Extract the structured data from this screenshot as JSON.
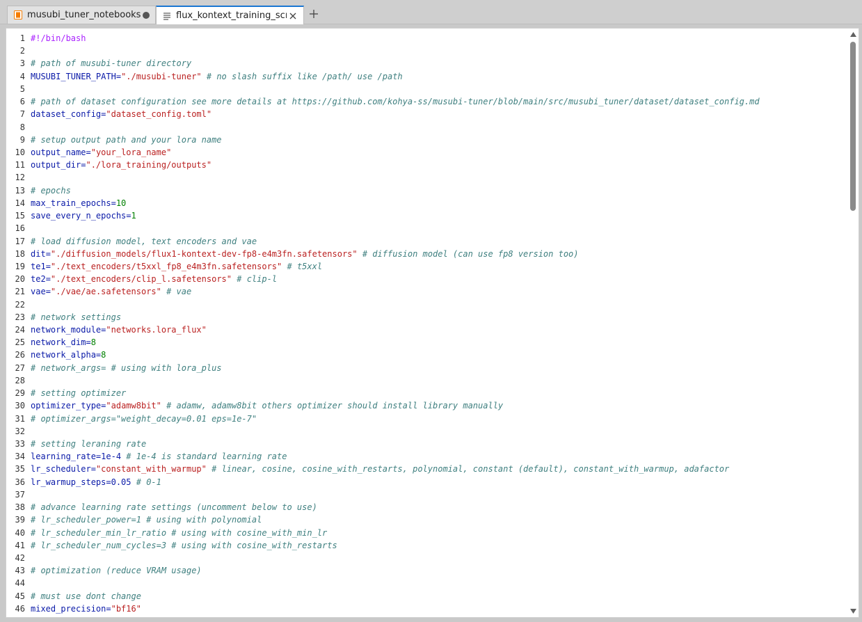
{
  "tabs": [
    {
      "label": "musubi_tuner_notebooks.ipy",
      "icon": "notebook-icon",
      "modified": true,
      "active": false
    },
    {
      "label": "flux_kontext_training_script.s",
      "icon": "text-file-icon",
      "modified": false,
      "active": true
    }
  ],
  "colors": {
    "accent": "#1976d2",
    "notebook_icon": "#f57c00",
    "comment": "#408080",
    "string": "#ba2121",
    "number": "#008000",
    "variable": "#0a1aa8",
    "shebang": "#aa22ff"
  },
  "editor": {
    "lines": [
      {
        "n": "1",
        "tokens": [
          {
            "t": "#!/bin/bash",
            "c": "shebang"
          }
        ]
      },
      {
        "n": "2",
        "tokens": []
      },
      {
        "n": "3",
        "tokens": [
          {
            "t": "# path of musubi-tuner directory",
            "c": "comment"
          }
        ]
      },
      {
        "n": "4",
        "tokens": [
          {
            "t": "MUSUBI_TUNER_PATH",
            "c": "var"
          },
          {
            "t": "=",
            "c": "op"
          },
          {
            "t": "\"./musubi-tuner\"",
            "c": "str"
          },
          {
            "t": " # no slash suffix like /path/ use /path",
            "c": "comment"
          }
        ]
      },
      {
        "n": "5",
        "tokens": []
      },
      {
        "n": "6",
        "tokens": [
          {
            "t": "# path of dataset configuration see more details at https://github.com/kohya-ss/musubi-tuner/blob/main/src/musubi_tuner/dataset/dataset_config.md",
            "c": "comment"
          }
        ]
      },
      {
        "n": "7",
        "tokens": [
          {
            "t": "dataset_config",
            "c": "var"
          },
          {
            "t": "=",
            "c": "op"
          },
          {
            "t": "\"dataset_config.toml\"",
            "c": "str"
          }
        ]
      },
      {
        "n": "8",
        "tokens": []
      },
      {
        "n": "9",
        "tokens": [
          {
            "t": "# setup output path and your lora name",
            "c": "comment"
          }
        ]
      },
      {
        "n": "10",
        "tokens": [
          {
            "t": "output_name",
            "c": "var"
          },
          {
            "t": "=",
            "c": "op"
          },
          {
            "t": "\"your_lora_name\"",
            "c": "str"
          }
        ]
      },
      {
        "n": "11",
        "tokens": [
          {
            "t": "output_dir",
            "c": "var"
          },
          {
            "t": "=",
            "c": "op"
          },
          {
            "t": "\"./lora_training/outputs\"",
            "c": "str"
          }
        ]
      },
      {
        "n": "12",
        "tokens": []
      },
      {
        "n": "13",
        "tokens": [
          {
            "t": "# epochs",
            "c": "comment"
          }
        ]
      },
      {
        "n": "14",
        "tokens": [
          {
            "t": "max_train_epochs",
            "c": "var"
          },
          {
            "t": "=",
            "c": "op"
          },
          {
            "t": "10",
            "c": "num"
          }
        ]
      },
      {
        "n": "15",
        "tokens": [
          {
            "t": "save_every_n_epochs",
            "c": "var"
          },
          {
            "t": "=",
            "c": "op"
          },
          {
            "t": "1",
            "c": "num"
          }
        ]
      },
      {
        "n": "16",
        "tokens": []
      },
      {
        "n": "17",
        "tokens": [
          {
            "t": "# load diffusion model, text encoders and vae",
            "c": "comment"
          }
        ]
      },
      {
        "n": "18",
        "tokens": [
          {
            "t": "dit",
            "c": "var"
          },
          {
            "t": "=",
            "c": "op"
          },
          {
            "t": "\"./diffusion_models/flux1-kontext-dev-fp8-e4m3fn.safetensors\"",
            "c": "str"
          },
          {
            "t": " # diffusion model (can use fp8 version too)",
            "c": "comment"
          }
        ]
      },
      {
        "n": "19",
        "tokens": [
          {
            "t": "te1",
            "c": "var"
          },
          {
            "t": "=",
            "c": "op"
          },
          {
            "t": "\"./text_encoders/t5xxl_fp8_e4m3fn.safetensors\"",
            "c": "str"
          },
          {
            "t": " # t5xxl",
            "c": "comment"
          }
        ]
      },
      {
        "n": "20",
        "tokens": [
          {
            "t": "te2",
            "c": "var"
          },
          {
            "t": "=",
            "c": "op"
          },
          {
            "t": "\"./text_encoders/clip_l.safetensors\"",
            "c": "str"
          },
          {
            "t": " # clip-l",
            "c": "comment"
          }
        ]
      },
      {
        "n": "21",
        "tokens": [
          {
            "t": "vae",
            "c": "var"
          },
          {
            "t": "=",
            "c": "op"
          },
          {
            "t": "\"./vae/ae.safetensors\"",
            "c": "str"
          },
          {
            "t": " # vae",
            "c": "comment"
          }
        ]
      },
      {
        "n": "22",
        "tokens": []
      },
      {
        "n": "23",
        "tokens": [
          {
            "t": "# network settings",
            "c": "comment"
          }
        ]
      },
      {
        "n": "24",
        "tokens": [
          {
            "t": "network_module",
            "c": "var"
          },
          {
            "t": "=",
            "c": "op"
          },
          {
            "t": "\"networks.lora_flux\"",
            "c": "str"
          }
        ]
      },
      {
        "n": "25",
        "tokens": [
          {
            "t": "network_dim",
            "c": "var"
          },
          {
            "t": "=",
            "c": "op"
          },
          {
            "t": "8",
            "c": "num"
          }
        ]
      },
      {
        "n": "26",
        "tokens": [
          {
            "t": "network_alpha",
            "c": "var"
          },
          {
            "t": "=",
            "c": "op"
          },
          {
            "t": "8",
            "c": "num"
          }
        ]
      },
      {
        "n": "27",
        "tokens": [
          {
            "t": "# network_args= # using with lora_plus",
            "c": "comment"
          }
        ]
      },
      {
        "n": "28",
        "tokens": []
      },
      {
        "n": "29",
        "tokens": [
          {
            "t": "# setting optimizer",
            "c": "comment"
          }
        ]
      },
      {
        "n": "30",
        "tokens": [
          {
            "t": "optimizer_type",
            "c": "var"
          },
          {
            "t": "=",
            "c": "op"
          },
          {
            "t": "\"adamw8bit\"",
            "c": "str"
          },
          {
            "t": " # adamw, adamw8bit others optimizer should install library manually",
            "c": "comment"
          }
        ]
      },
      {
        "n": "31",
        "tokens": [
          {
            "t": "# optimizer_args=\"weight_decay=0.01 eps=1e-7\"",
            "c": "comment"
          }
        ]
      },
      {
        "n": "32",
        "tokens": []
      },
      {
        "n": "33",
        "tokens": [
          {
            "t": "# setting leraning rate",
            "c": "comment"
          }
        ]
      },
      {
        "n": "34",
        "tokens": [
          {
            "t": "learning_rate",
            "c": "var"
          },
          {
            "t": "=",
            "c": "op"
          },
          {
            "t": "1e-4",
            "c": "var"
          },
          {
            "t": " # 1e-4 is standard learning rate",
            "c": "comment"
          }
        ]
      },
      {
        "n": "35",
        "tokens": [
          {
            "t": "lr_scheduler",
            "c": "var"
          },
          {
            "t": "=",
            "c": "op"
          },
          {
            "t": "\"constant_with_warmup\"",
            "c": "str"
          },
          {
            "t": " # linear, cosine, cosine_with_restarts, polynomial, constant (default), constant_with_warmup, adafactor",
            "c": "comment"
          }
        ]
      },
      {
        "n": "36",
        "tokens": [
          {
            "t": "lr_warmup_steps",
            "c": "var"
          },
          {
            "t": "=",
            "c": "op"
          },
          {
            "t": "0.05",
            "c": "var"
          },
          {
            "t": " # 0-1",
            "c": "comment"
          }
        ]
      },
      {
        "n": "37",
        "tokens": []
      },
      {
        "n": "38",
        "tokens": [
          {
            "t": "# advance learning rate settings (uncomment below to use)",
            "c": "comment"
          }
        ]
      },
      {
        "n": "39",
        "tokens": [
          {
            "t": "# lr_scheduler_power=1 # using with polynomial",
            "c": "comment"
          }
        ]
      },
      {
        "n": "40",
        "tokens": [
          {
            "t": "# lr_scheduler_min_lr_ratio # using with cosine_with_min_lr",
            "c": "comment"
          }
        ]
      },
      {
        "n": "41",
        "tokens": [
          {
            "t": "# lr_scheduler_num_cycles=3 # using with cosine_with_restarts",
            "c": "comment"
          }
        ]
      },
      {
        "n": "42",
        "tokens": []
      },
      {
        "n": "43",
        "tokens": [
          {
            "t": "# optimization (reduce VRAM usage)",
            "c": "comment"
          }
        ]
      },
      {
        "n": "44",
        "tokens": []
      },
      {
        "n": "45",
        "tokens": [
          {
            "t": "# must use dont change",
            "c": "comment"
          }
        ]
      },
      {
        "n": "46",
        "tokens": [
          {
            "t": "mixed_precision",
            "c": "var"
          },
          {
            "t": "=",
            "c": "op"
          },
          {
            "t": "\"bf16\"",
            "c": "str"
          }
        ]
      }
    ]
  }
}
